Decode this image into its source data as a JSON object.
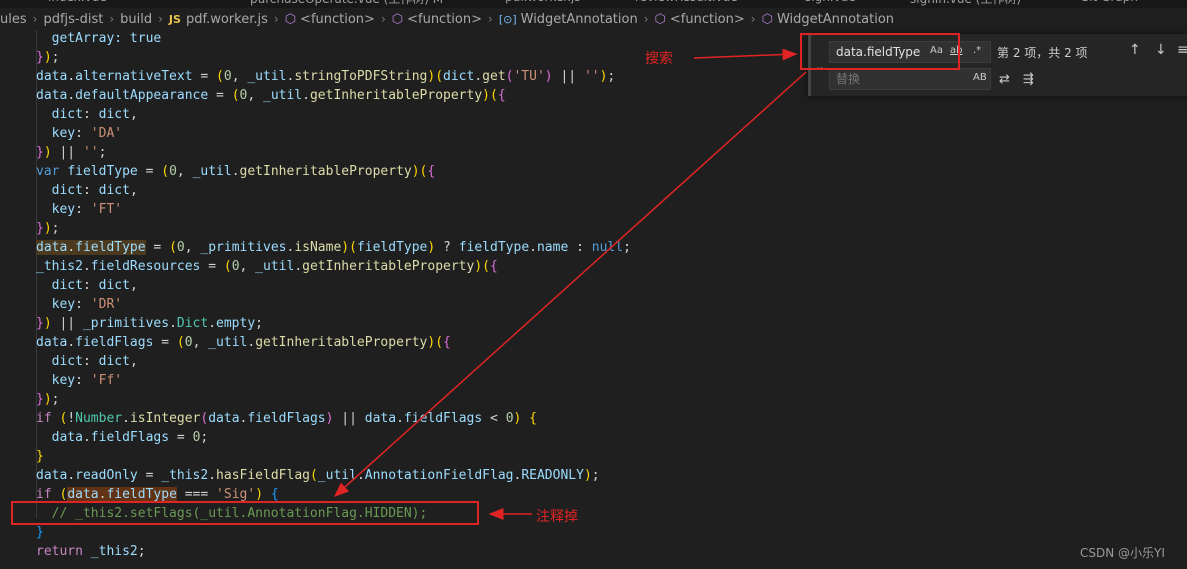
{
  "tabs": [
    "index.vue",
    "purchaseOperate.vue (工作树) M",
    "pdf.worker.js",
    "reviewResult.vue",
    "sign.vue",
    "signIn.vue (工作树)",
    "Git Graph"
  ],
  "breadcrumb": [
    "ules",
    "pdfjs-dist",
    "build",
    "pdf.worker.js",
    "<function>",
    "<function>",
    "WidgetAnnotation",
    "<function>",
    "WidgetAnnotation"
  ],
  "breadcrumb_js": "JS",
  "find": {
    "query": "data.fieldType",
    "replace_placeholder": "替换",
    "match_case": "Aa",
    "whole_word": "ab",
    "regex": ".*",
    "preserve_case": "AB",
    "result": "第 2 项，共 2 项",
    "prev": "↑",
    "next": "↓",
    "more": "≡"
  },
  "code_first_line": "getArray: true",
  "annotations": {
    "search": "搜索",
    "comment_out": "注释掉"
  },
  "watermark": "CSDN @小乐YI"
}
